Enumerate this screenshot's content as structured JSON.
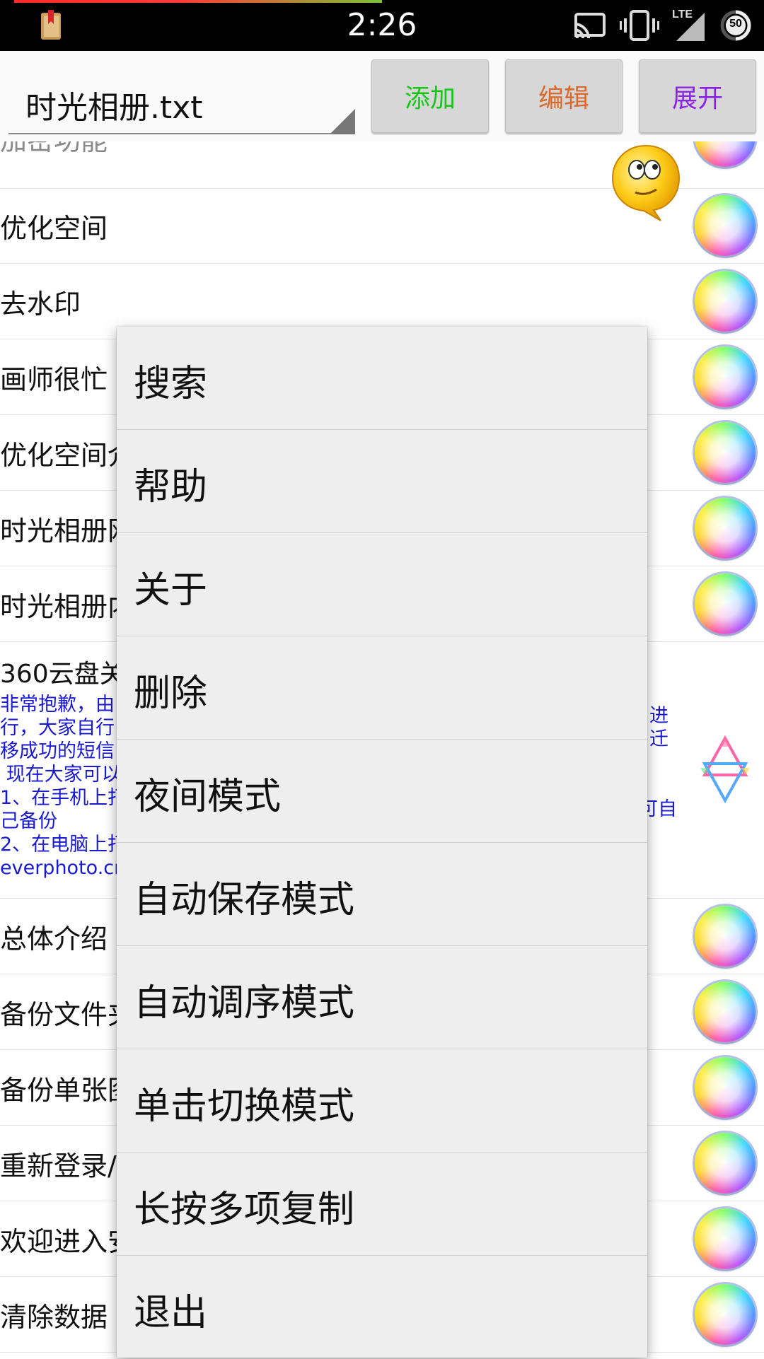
{
  "status_bar": {
    "time": "2:26",
    "network": "LTE",
    "battery": "50",
    "icons": [
      "book-icon",
      "cast-icon",
      "vibrate-icon",
      "signal-icon",
      "battery-icon"
    ]
  },
  "toolbar": {
    "file_select": "时光相册.txt",
    "add_label": "添加",
    "edit_label": "编辑",
    "expand_label": "展开",
    "colors": {
      "add": "#18c518",
      "edit": "#d9692a",
      "expand": "#8b22e8"
    }
  },
  "list": {
    "items": [
      {
        "label": "加密功能"
      },
      {
        "label": "优化空间"
      },
      {
        "label": "去水印"
      },
      {
        "label": "画师很忙"
      },
      {
        "label": "优化空间介"
      },
      {
        "label": "时光相册网"
      },
      {
        "label": "时光相册内"
      }
    ],
    "note": {
      "title": "360云盘关",
      "lines": [
        "非常抱歉，由",
        "行，大家自行",
        "移成功的短信",
        " 现在大家可以",
        "1、在手机上打",
        "己备份",
        "2、在电脑上打",
        "everphoto.cn"
      ],
      "fragments": [
        "进",
        "迁",
        "可自"
      ]
    },
    "items_after": [
      {
        "label": "总体介绍"
      },
      {
        "label": "备份文件夹"
      },
      {
        "label": "备份单张图"
      },
      {
        "label": "重新登录/"
      },
      {
        "label": "欢迎进入安"
      },
      {
        "label": "清除数据"
      }
    ]
  },
  "menu": {
    "items": [
      "搜索",
      "帮助",
      "关于",
      "删除",
      "夜间模式",
      "自动保存模式",
      "自动调序模式",
      "单击切换模式",
      "长按多项复制",
      "退出"
    ]
  }
}
